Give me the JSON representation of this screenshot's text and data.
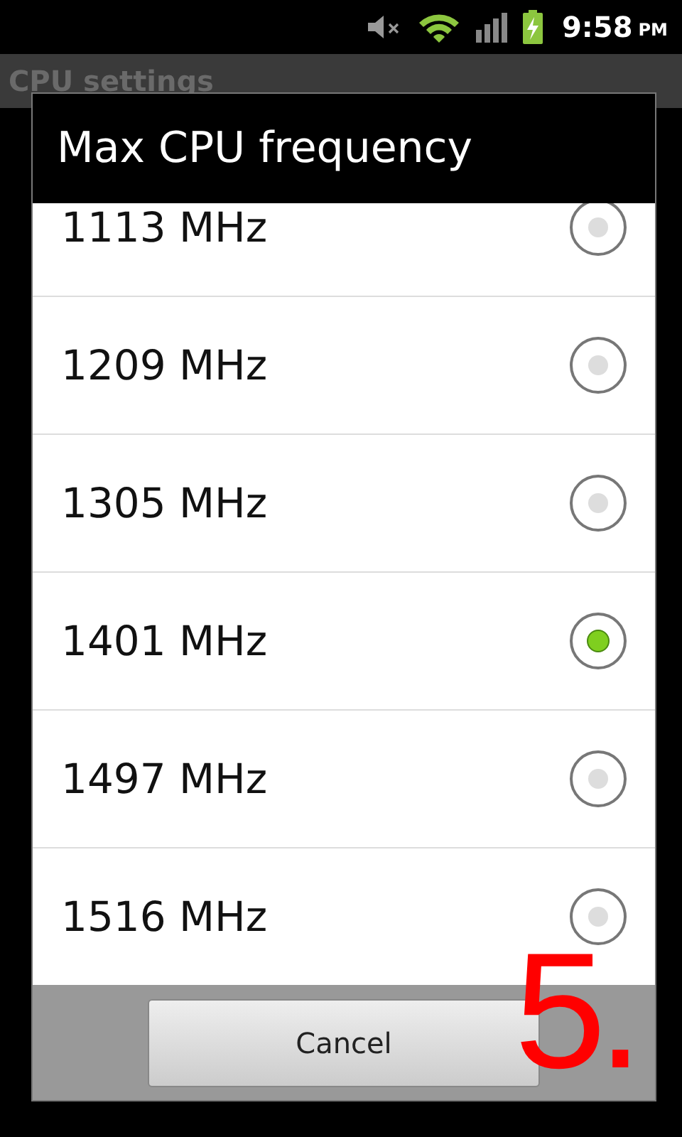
{
  "status_bar": {
    "time": "9:58",
    "ampm": "PM"
  },
  "app_bar": {
    "title": "CPU settings"
  },
  "dialog": {
    "title": "Max CPU frequency",
    "options": [
      {
        "label": "1113 MHz",
        "selected": false
      },
      {
        "label": "1209 MHz",
        "selected": false
      },
      {
        "label": "1305 MHz",
        "selected": false
      },
      {
        "label": "1401 MHz",
        "selected": true
      },
      {
        "label": "1497 MHz",
        "selected": false
      },
      {
        "label": "1516 MHz",
        "selected": false
      }
    ],
    "buttons": [
      "Cancel"
    ]
  },
  "step_label": "5."
}
